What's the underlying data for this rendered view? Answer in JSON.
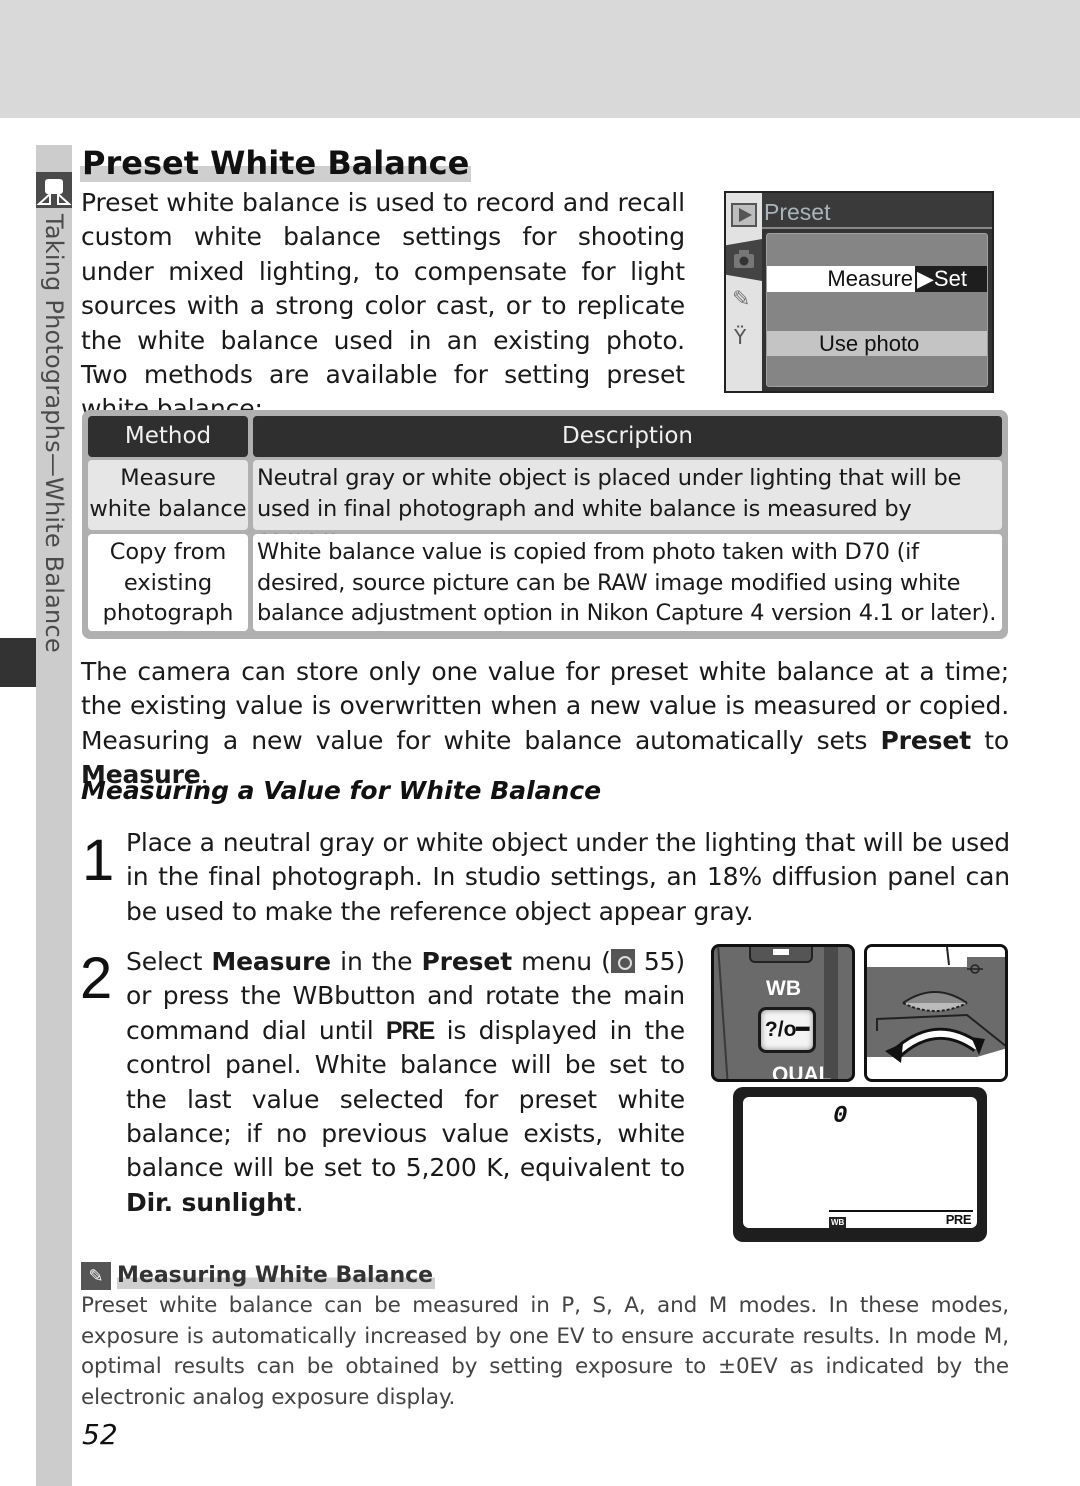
{
  "sidebar": {
    "section_label": "Taking Photographs—White Balance",
    "icon": "camera-shooting-icon"
  },
  "title": "Preset White Balance",
  "intro": "Preset white balance is used to record and recall custom white balance settings for shooting under mixed lighting, to compensate for light sources with a strong color cast, or to replicate the white balance used in an existing photo. Two methods are available for setting preset white balance:",
  "camera_menu": {
    "title": "Preset",
    "tabs": [
      "playback-icon",
      "shooting-camera-icon",
      "custom-settings-pencil-icon",
      "setup-wrench-icon"
    ],
    "items": [
      {
        "label": "Measure",
        "action": "▶Set",
        "selected": true
      },
      {
        "label": "Use photo",
        "selected": false
      }
    ]
  },
  "table": {
    "headers": [
      "Method",
      "Description"
    ],
    "rows": [
      {
        "method": "Measure\nwhite balance",
        "description": "Neutral gray or white object is placed under lighting that will be used in final photograph and white balance is measured by camera."
      },
      {
        "method": "Copy from\nexisting\nphotograph",
        "description": "White balance value is copied from photo taken with D70 (if desired, source picture can be RAW image modified using white balance adjustment option in Nikon Capture 4 version 4.1 or later)."
      }
    ]
  },
  "paragraph": {
    "text_1": "The camera can store only one value for preset white balance at a time; the existing  value is overwritten when a new value is measured or copied.  Measuring a new value for white balance automatically sets ",
    "bold_1": "Preset",
    "text_2": " to ",
    "bold_2": "Measure",
    "text_3": "."
  },
  "subheading": "Measuring a Value for White Balance",
  "steps": [
    {
      "number": "1",
      "text": "Place a neutral gray or white object under the lighting that will be used in the final photograph.  In studio settings, an 18% diffusion panel can be used to make the reference object appear gray."
    },
    {
      "number": "2",
      "t1": "Select ",
      "b1": "Measure",
      "t2": " in the ",
      "b2": "Preset",
      "t3": " menu (",
      "ref_page": " 55) or press the ",
      "wb": "WB",
      "t4": "button and rotate the main command dial until ",
      "pre": "PRE",
      "t5": " is displayed in the control panel.  White balance will be set to the last value selected for preset white balance; if no previous value exists, white balance will be set to 5,200 K, equivalent to ",
      "b3": "Dir. sunlight",
      "t6": "."
    }
  ],
  "illustrations": {
    "wb_button_label": "WB",
    "key_label": "?/o━",
    "qual_label": "QUAL",
    "lcd_digit": "0",
    "lcd_wb": "WB",
    "lcd_pre": "PRE"
  },
  "note": {
    "icon": "pencil-note-icon",
    "title": "Measuring White Balance",
    "body": "Preset white balance can be measured in P, S, A, and M modes.  In these modes, exposure is automatically increased by one EV to ensure accurate results.  In mode M, optimal results can be obtained by setting exposure to ±0EV as indicated by the electronic analog exposure display."
  },
  "page_number": "52"
}
